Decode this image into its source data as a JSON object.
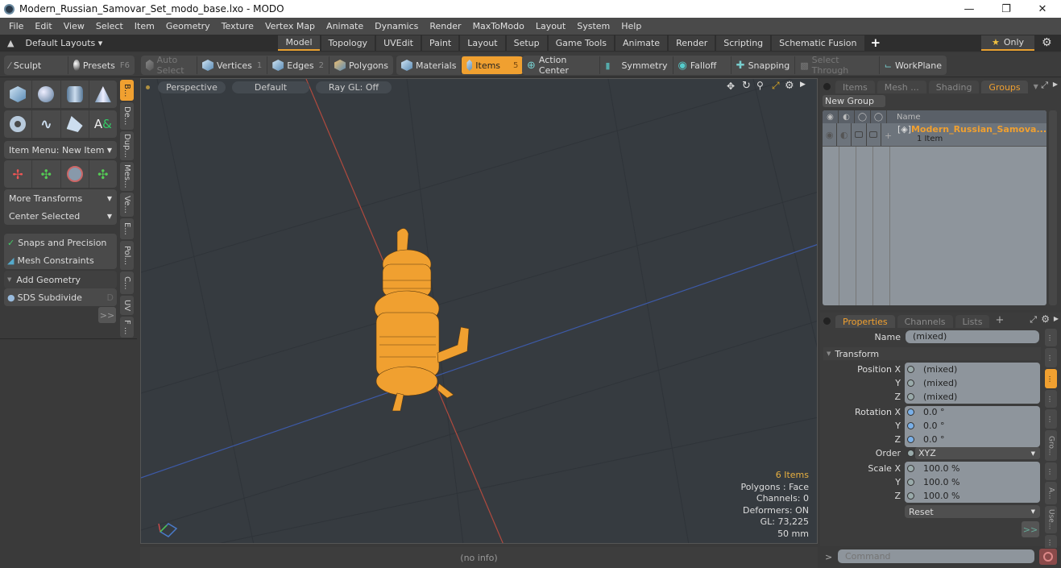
{
  "window": {
    "title": "Modern_Russian_Samovar_Set_modo_base.lxo - MODO",
    "controls": [
      "minimize",
      "restore",
      "close"
    ]
  },
  "menu": [
    "File",
    "Edit",
    "View",
    "Select",
    "Item",
    "Geometry",
    "Texture",
    "Vertex Map",
    "Animate",
    "Dynamics",
    "Render",
    "MaxToModo",
    "Layout",
    "System",
    "Help"
  ],
  "layout_bar": {
    "layouts_label": "Default Layouts",
    "tabs": [
      "Model",
      "Topology",
      "UVEdit",
      "Paint",
      "Layout",
      "Setup",
      "Game Tools",
      "Animate",
      "Render",
      "Scripting",
      "Schematic Fusion"
    ],
    "active_tab": "Model",
    "add_label": "+",
    "only_label": "Only"
  },
  "toolbar": {
    "sculpt": "Sculpt",
    "presets": "Presets",
    "presets_key": "F6",
    "auto_select": "Auto Select",
    "vertices": "Vertices",
    "vertices_key": "1",
    "edges": "Edges",
    "edges_key": "2",
    "polygons": "Polygons",
    "materials": "Materials",
    "items": "Items",
    "items_key": "5",
    "action_center": "Action Center",
    "symmetry": "Symmetry",
    "falloff": "Falloff",
    "snapping": "Snapping",
    "select_through": "Select Through",
    "workplane": "WorkPlane"
  },
  "left_panel": {
    "item_menu": "Item Menu: New Item",
    "more_transforms": "More Transforms",
    "center_selected": "Center Selected",
    "snaps": "Snaps and Precision",
    "mesh_constraints": "Mesh Constraints",
    "add_geometry": "Add Geometry",
    "sds_subdivide": "SDS Subdivide",
    "sds_key": "D",
    "expand": ">>",
    "side_tabs": [
      "B...",
      "De...",
      "Dup...",
      "Mes...",
      "Ve...",
      "E...",
      "Pol...",
      "C...",
      "UV",
      "F ..."
    ]
  },
  "viewport": {
    "view": "Perspective",
    "shading": "Default",
    "raygl": "Ray GL: Off",
    "stats": {
      "items": "6 Items",
      "polygons": "Polygons : Face",
      "channels": "Channels: 0",
      "deformers": "Deformers: ON",
      "gl": "GL: 73,225",
      "unit": "50 mm"
    },
    "status": "(no info)",
    "colors": {
      "wire": "#f0a030",
      "x_axis": "#c05040",
      "z_axis": "#4060b0"
    }
  },
  "groups_panel": {
    "tabs": [
      "Items",
      "Mesh ...",
      "Shading",
      "Groups"
    ],
    "active_tab": "Groups",
    "new_group": "New Group",
    "column_name": "Name",
    "group": {
      "name": "Modern_Russian_Samova...",
      "count": "1 Item"
    }
  },
  "properties_panel": {
    "tabs": [
      "Properties",
      "Channels",
      "Lists"
    ],
    "active_tab": "Properties",
    "add": "+",
    "name_label": "Name",
    "name_value": "(mixed)",
    "section": "Transform",
    "position": {
      "label": "Position X",
      "x": "(mixed)",
      "y": "(mixed)",
      "z": "(mixed)"
    },
    "rotation": {
      "label": "Rotation X",
      "x": "0.0 °",
      "y": "0.0 °",
      "z": "0.0 °"
    },
    "order": {
      "label": "Order",
      "value": "XYZ"
    },
    "scale": {
      "label": "Scale X",
      "x": "100.0 %",
      "y": "100.0 %",
      "z": "100.0 %"
    },
    "axis_y": "Y",
    "axis_z": "Z",
    "reset": "Reset",
    "expand": ">>",
    "side_tabs": [
      "...",
      "...",
      "...",
      "...",
      "...",
      "Gro...",
      "...",
      "A...",
      "Use...",
      "..."
    ]
  },
  "command": {
    "prompt": ">",
    "placeholder": "Command"
  }
}
